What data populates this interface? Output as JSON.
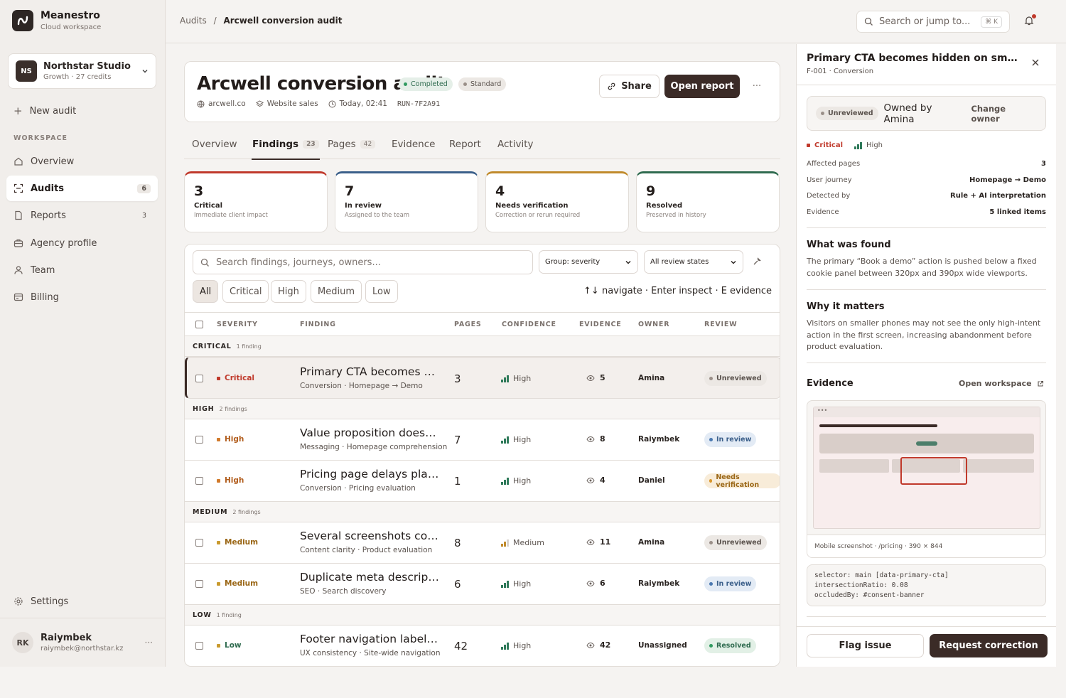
{
  "app": {
    "name": "Meanestro",
    "subtitle": "Cloud workspace"
  },
  "org": {
    "initials": "NS",
    "name": "Northstar Studio",
    "plan": "Growth · 27 credits"
  },
  "sidebar": {
    "new_audit": "New audit",
    "section_label": "WORKSPACE",
    "items": [
      {
        "label": "Overview",
        "icon": "home-icon"
      },
      {
        "label": "Audits",
        "icon": "scan-icon",
        "count": "6",
        "active": true
      },
      {
        "label": "Reports",
        "icon": "file-icon",
        "count": "3"
      },
      {
        "label": "Agency profile",
        "icon": "briefcase-icon"
      },
      {
        "label": "Team",
        "icon": "user-icon"
      },
      {
        "label": "Billing",
        "icon": "card-icon"
      }
    ],
    "settings": "Settings"
  },
  "user": {
    "initials": "RK",
    "name": "Raiymbek",
    "email": "raiymbek@northstar.kz"
  },
  "topbar": {
    "breadcrumb_parent": "Audits",
    "breadcrumb_sep": "/",
    "breadcrumb_current": "Arcwell conversion audit",
    "search_placeholder": "Search or jump to...",
    "search_kbd": "⌘ K"
  },
  "audit": {
    "title": "Arcwell conversion audit",
    "status": "Completed",
    "tier": "Standard",
    "domain": "arcwell.co",
    "category": "Website sales",
    "time": "Today, 02:41",
    "run_id": "RUN-7F2A91",
    "share": "Share",
    "open_report": "Open report",
    "more": "···"
  },
  "tabs": [
    {
      "label": "Overview"
    },
    {
      "label": "Findings",
      "count": "23",
      "active": true
    },
    {
      "label": "Pages",
      "count": "42"
    },
    {
      "label": "Evidence"
    },
    {
      "label": "Report"
    },
    {
      "label": "Activity"
    }
  ],
  "stats": [
    {
      "value": "3",
      "label": "Critical",
      "sub": "Immediate client impact",
      "color": "#c0392b"
    },
    {
      "value": "7",
      "label": "In review",
      "sub": "Assigned to the team",
      "color": "#3b5f8a"
    },
    {
      "value": "4",
      "label": "Needs verification",
      "sub": "Correction or rerun required",
      "color": "#c08a2b"
    },
    {
      "value": "9",
      "label": "Resolved",
      "sub": "Preserved in history",
      "color": "#2f6b4f"
    }
  ],
  "filters": {
    "search_placeholder": "Search findings, journeys, owners...",
    "group": "Group: severity",
    "review_state": "All review states",
    "chips": [
      "All",
      "Critical",
      "High",
      "Medium",
      "Low"
    ],
    "keyboard_hint": "↑↓ navigate · Enter inspect · E evidence"
  },
  "columns": [
    "SEVERITY",
    "FINDING",
    "PAGES",
    "CONFIDENCE",
    "EVIDENCE",
    "OWNER",
    "REVIEW"
  ],
  "groups": [
    {
      "name": "CRITICAL",
      "count": "1 finding"
    },
    {
      "name": "HIGH",
      "count": "2 findings"
    },
    {
      "name": "MEDIUM",
      "count": "2 findings"
    },
    {
      "name": "LOW",
      "count": "1 finding"
    }
  ],
  "rows": [
    {
      "severity": "Critical",
      "title": "Primary CTA becomes hidden on small mobile viewports",
      "sub": "Conversion · Homepage → Demo",
      "pages": "3",
      "confidence": "High",
      "evidence": "5",
      "owner": "Amina",
      "review": "Unreviewed"
    },
    {
      "severity": "High",
      "title": "Value proposition does not explain the outcome",
      "sub": "Messaging · Homepage comprehension",
      "pages": "7",
      "confidence": "High",
      "evidence": "8",
      "owner": "Raiymbek",
      "review": "In review"
    },
    {
      "severity": "High",
      "title": "Pricing page delays plan comparison",
      "sub": "Conversion · Pricing evaluation",
      "pages": "1",
      "confidence": "High",
      "evidence": "4",
      "owner": "Daniel",
      "review": "Needs verification"
    },
    {
      "severity": "Medium",
      "title": "Several screenshots contain outdated UI",
      "sub": "Content clarity · Product evaluation",
      "pages": "8",
      "confidence": "Medium",
      "evidence": "11",
      "owner": "Amina",
      "review": "Unreviewed"
    },
    {
      "severity": "Medium",
      "title": "Duplicate meta descriptions across pages",
      "sub": "SEO · Search discovery",
      "pages": "6",
      "confidence": "High",
      "evidence": "6",
      "owner": "Raiymbek",
      "review": "In review"
    },
    {
      "severity": "Low",
      "title": "Footer navigation label does not match header",
      "sub": "UX consistency · Site-wide navigation",
      "pages": "42",
      "confidence": "High",
      "evidence": "42",
      "owner": "Unassigned",
      "review": "Resolved"
    }
  ],
  "panel": {
    "title": "Primary CTA becomes hidden on small mobile viewports",
    "sub": "F-001 · Conversion",
    "status": "Unreviewed",
    "owned_by": "Owned by Amina",
    "change_owner": "Change owner",
    "severity": "Critical",
    "confidence": "High",
    "facts": [
      {
        "k": "Affected pages",
        "v": "3"
      },
      {
        "k": "User journey",
        "v": "Homepage → Demo"
      },
      {
        "k": "Detected by",
        "v": "Rule + AI interpretation"
      },
      {
        "k": "Evidence",
        "v": "5 linked items"
      }
    ],
    "found_title": "What was found",
    "found_text": "The primary “Book a demo” action is pushed below a fixed cookie panel between 320px and 390px wide viewports.",
    "matters_title": "Why it matters",
    "matters_text": "Visitors on smaller phones may not see the only high-intent action in the first screen, increasing abandonment before product evaluation.",
    "evidence_title": "Evidence",
    "open_workspace": "Open workspace",
    "screenshot_caption": "Mobile screenshot · /pricing · 390 × 844",
    "code": [
      "selector: main [data-primary-cta]",
      "intersectionRatio: 0.08",
      "occludedBy: #consent-banner"
    ],
    "flag": "Flag issue",
    "request": "Request correction"
  }
}
